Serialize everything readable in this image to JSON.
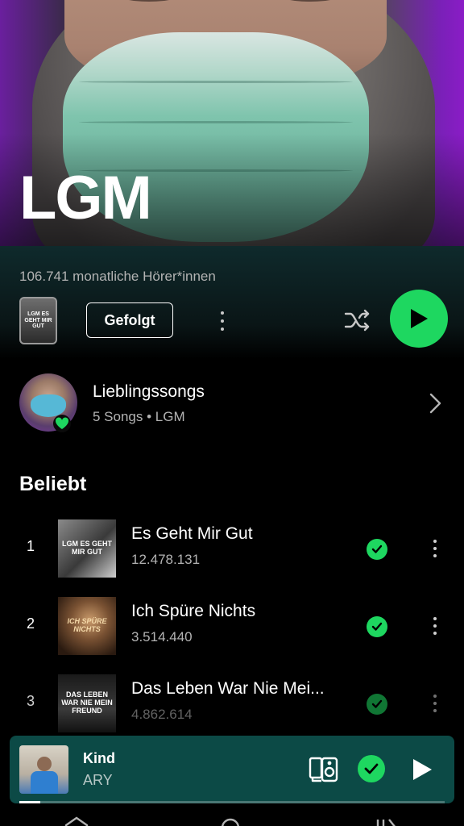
{
  "artist": {
    "name": "LGM",
    "monthly_listeners": "106.741 monatliche Hörer*innen",
    "cover_text": "LGM ES GEHT MIR GUT"
  },
  "actions": {
    "follow_label": "Gefolgt"
  },
  "liked_songs": {
    "title": "Lieblingssongs",
    "subtitle": "5 Songs • LGM"
  },
  "popular": {
    "title": "Beliebt",
    "tracks": [
      {
        "rank": "1",
        "name": "Es Geht Mir Gut",
        "plays": "12.478.131",
        "art_text": "LGM ES GEHT MIR GUT",
        "downloaded": true
      },
      {
        "rank": "2",
        "name": "Ich Spüre Nichts",
        "plays": "3.514.440",
        "art_text": "ICH SPÜRE NICHTS",
        "downloaded": true
      },
      {
        "rank": "3",
        "name": "Das Leben War Nie Mei...",
        "plays": "4.862.614",
        "art_text": "DAS LEBEN WAR NIE MEIN FREUND",
        "downloaded": true
      }
    ]
  },
  "now_playing": {
    "title": "Kind",
    "artist": "ARY",
    "progress": 0.05
  },
  "colors": {
    "accent": "#1ed760",
    "mini_player_bg": "#0c4a46",
    "band_top": "#0f2a2c"
  },
  "icons": [
    "shuffle-icon",
    "play-icon",
    "more-icon",
    "chevron-right-icon",
    "check-icon",
    "heart-icon",
    "connect-device-icon",
    "home-icon",
    "search-icon",
    "library-icon"
  ]
}
